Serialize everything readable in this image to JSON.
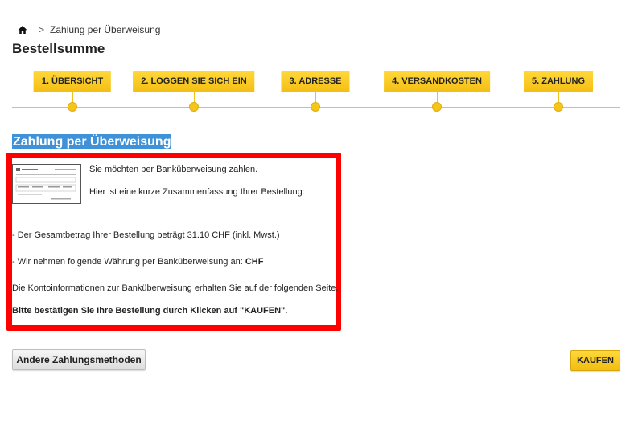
{
  "breadcrumb": {
    "home_icon": "home-icon",
    "separator": ">",
    "current": "Zahlung per Überweisung"
  },
  "page_title": "Bestellsumme",
  "steps": [
    {
      "label": "1. ÜBERSICHT"
    },
    {
      "label": "2. LOGGEN SIE SICH EIN"
    },
    {
      "label": "3. ADRESSE"
    },
    {
      "label": "4. VERSANDKOSTEN"
    },
    {
      "label": "5. ZAHLUNG"
    }
  ],
  "section": {
    "heading": "Zahlung per Überweisung",
    "intro": "Sie möchten per Banküberweisung zahlen.",
    "summary_intro": "Hier ist eine kurze Zusammenfassung Ihrer Bestellung:",
    "total_line": "- Der Gesamtbetrag Ihrer Bestellung beträgt 31.10 CHF (inkl. Mwst.)",
    "currency_prefix": "- Wir nehmen folgende Währung per Banküberweisung an: ",
    "currency": "CHF",
    "account_info": "Die Kontoinformationen zur Banküberweisung erhalten Sie auf der folgenden Seite.",
    "confirm": "Bitte bestätigen Sie Ihre Bestellung durch Klicken auf \"KAUFEN\"."
  },
  "buttons": {
    "other_methods": "Andere Zahlungsmethoden",
    "buy": "KAUFEN"
  },
  "colors": {
    "accent_yellow": "#f5c518",
    "highlight_red": "#ff0000",
    "heading_bg": "#3f92d8"
  }
}
